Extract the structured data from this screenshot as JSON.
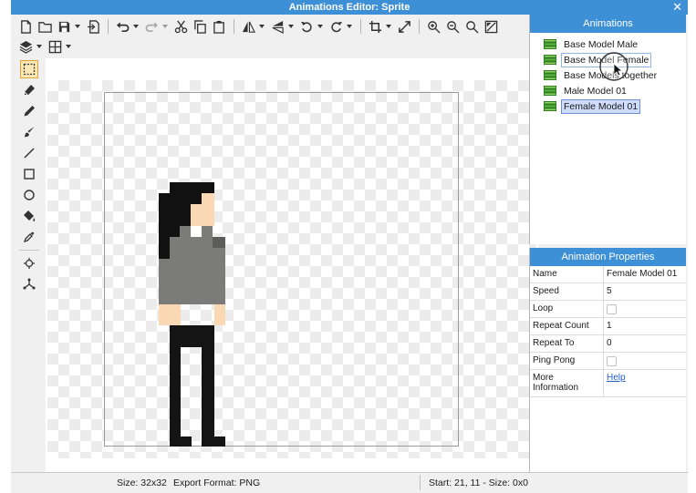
{
  "window": {
    "title": "Animations Editor: Sprite",
    "close_glyph": "✕"
  },
  "toolbar": {
    "row1": [
      "new-file-icon",
      "open-folder-icon",
      "save-icon",
      "export-icon",
      "undo-icon",
      "redo-icon",
      "cut-icon",
      "copy-icon",
      "paste-icon",
      "flip-horizontal-icon",
      "flip-vertical-icon",
      "rotate-left-icon",
      "rotate-right-icon",
      "crop-icon",
      "resize-icon",
      "zoom-in-icon",
      "zoom-out-icon",
      "zoom-fit-icon",
      "zoom-actual-icon"
    ],
    "row2": [
      "layers-icon",
      "grid-icon"
    ]
  },
  "tools": [
    "selection-tool-icon",
    "eraser-icon",
    "pencil-icon",
    "brush-icon",
    "line-icon",
    "rectangle-icon",
    "ellipse-icon",
    "fill-bucket-icon",
    "eyedropper-icon",
    "origin-point-icon",
    "attach-point-icon"
  ],
  "animations_panel": {
    "title": "Animations",
    "items": [
      {
        "label": "Base Model Male"
      },
      {
        "label": "Base Model Female"
      },
      {
        "label": "Base Models together"
      },
      {
        "label": "Male Model 01"
      },
      {
        "label": "Female Model 01"
      }
    ],
    "hovered_index": 1,
    "selected_index": 4
  },
  "properties_panel": {
    "title": "Animation Properties",
    "name": {
      "label": "Name",
      "value": "Female Model 01"
    },
    "speed": {
      "label": "Speed",
      "value": "5"
    },
    "loop": {
      "label": "Loop",
      "checked": false
    },
    "repeat_count": {
      "label": "Repeat Count",
      "value": "1"
    },
    "repeat_to": {
      "label": "Repeat To",
      "value": "0"
    },
    "ping_pong": {
      "label": "Ping Pong",
      "checked": false
    },
    "more_info": {
      "label": "More Information",
      "value": "Help"
    }
  },
  "statusbar": {
    "size": "Size: 32x32",
    "export_format": "Export Format: PNG",
    "position": "Start: 21, 11 - Size: 0x0"
  },
  "colors": {
    "accent": "#3d8fd6",
    "selection": "#cfdcfb",
    "hair": "#111111",
    "skin": "#fbd8b4",
    "shirt": "#7b7b79",
    "pants": "#141414"
  }
}
